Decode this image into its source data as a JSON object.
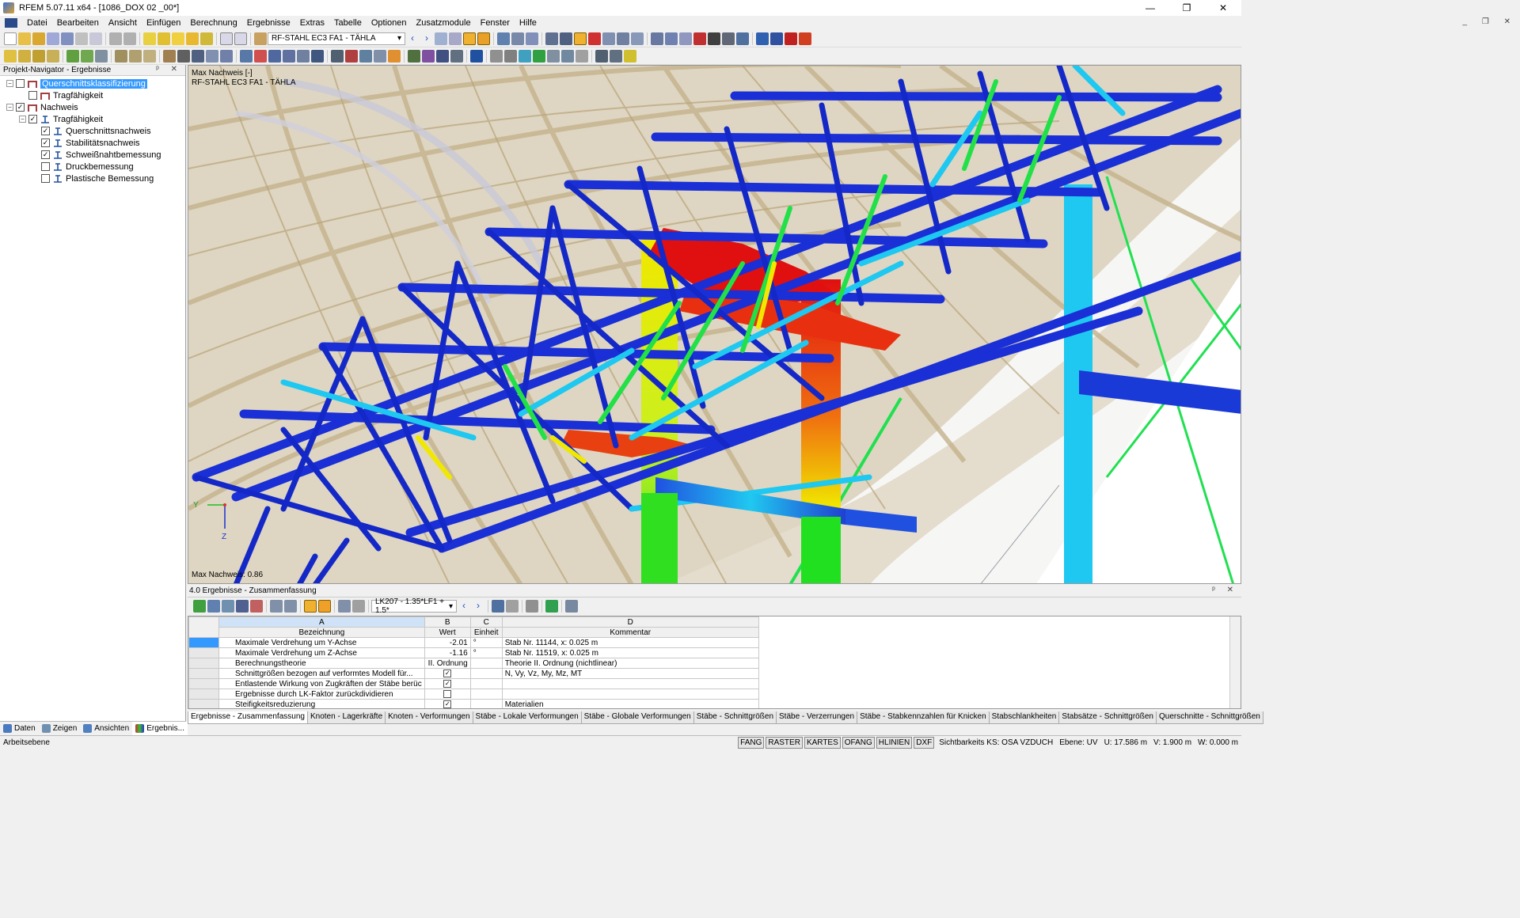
{
  "window": {
    "title": "RFEM 5.07.11 x64 - [1086_DOX 02 _00*]",
    "minimize": "—",
    "maximize": "❐",
    "close": "✕"
  },
  "menu": [
    "Datei",
    "Bearbeiten",
    "Ansicht",
    "Einfügen",
    "Berechnung",
    "Ergebnisse",
    "Extras",
    "Tabelle",
    "Optionen",
    "Zusatzmodule",
    "Fenster",
    "Hilfe"
  ],
  "mdi_controls": "_ ❐ ✕",
  "toolbar": {
    "module_combo": "RF-STAHL EC3 FA1 - TÄHLA"
  },
  "navigator": {
    "title": "Projekt-Navigator - Ergebnisse",
    "pins": "ᵖ ✕",
    "items": [
      {
        "label": "Querschnittsklassifizierung"
      },
      {
        "label": "Tragfähigkeit"
      },
      {
        "label": "Nachweis"
      },
      {
        "label": "Tragfähigkeit"
      },
      {
        "label": "Querschnittsnachweis"
      },
      {
        "label": "Stabilitätsnachweis"
      },
      {
        "label": "Schweißnahtbemessung"
      },
      {
        "label": "Druckbemessung"
      },
      {
        "label": "Plastische Bemessung"
      }
    ],
    "tabs": [
      "Daten",
      "Zeigen",
      "Ansichten",
      "Ergebnis..."
    ]
  },
  "viewport": {
    "label1": "Max Nachweis [-]",
    "label2": "RF-STAHL EC3 FA1 - TÄHLA",
    "footer": "Max Nachweis: 0.86",
    "axis_y": "Y",
    "axis_z": "Z"
  },
  "results": {
    "title": "4.0 Ergebnisse - Zusammenfassung",
    "pins": "ᵖ ✕",
    "lc_combo": "LK207 - 1.35*LF1 + 1.5*",
    "col_letters": [
      "A",
      "B",
      "C",
      "D"
    ],
    "col_headers": [
      "Bezeichnung",
      "Wert",
      "Einheit",
      "Kommentar"
    ],
    "rows": [
      {
        "name": "Maximale Verdrehung um Y-Achse",
        "value": "-2.01",
        "unit": "°",
        "comment": "Stab Nr. 11144, x: 0.025 m"
      },
      {
        "name": "Maximale Verdrehung um Z-Achse",
        "value": "-1.16",
        "unit": "°",
        "comment": "Stab Nr. 11519, x: 0.025 m"
      },
      {
        "name": "Berechnungstheorie",
        "value": "II. Ordnung",
        "unit": "",
        "comment": "Theorie II. Ordnung (nichtlinear)"
      },
      {
        "name": "Schnittgrößen bezogen auf verformtes Modell für...",
        "value": "✓",
        "unit": "",
        "comment": "N, Vy, Vz, My, Mz, MT"
      },
      {
        "name": "Entlastende Wirkung von Zugkräften der Stäbe berüc",
        "value": "✓",
        "unit": "",
        "comment": ""
      },
      {
        "name": "Ergebnisse durch LK-Faktor zurückdividieren",
        "value": "",
        "unit": "",
        "comment": ""
      },
      {
        "name": "Steifigkeitsreduzierung",
        "value": "✓",
        "unit": "",
        "comment": "Materialien"
      }
    ],
    "tabs": [
      "Ergebnisse - Zusammenfassung",
      "Knoten - Lagerkräfte",
      "Knoten - Verformungen",
      "Stäbe - Lokale Verformungen",
      "Stäbe - Globale Verformungen",
      "Stäbe - Schnittgrößen",
      "Stäbe - Verzerrungen",
      "Stäbe - Stabkennzahlen für Knicken",
      "Stabschlankheiten",
      "Stabsätze - Schnittgrößen",
      "Querschnitte - Schnittgrößen"
    ]
  },
  "status": {
    "left": "Arbeitsebene",
    "buttons": [
      "FANG",
      "RASTER",
      "KARTES",
      "OFANG",
      "HLINIEN",
      "DXF"
    ],
    "system": "Sichtbarkeits KS: OSA VZDUCH",
    "plane": "Ebene: UV",
    "u": "U: 17.586 m",
    "v": "V: 1.900 m",
    "w": "W: 0.000 m"
  },
  "colors": {
    "selection": "#3399ff",
    "beam_blue": "#1a2fd6",
    "beam_cyan": "#1ec8f0",
    "beam_red": "#e01010",
    "beam_yellow": "#f0e800",
    "beam_green": "#20e020",
    "timber": "#d2c3a3"
  }
}
